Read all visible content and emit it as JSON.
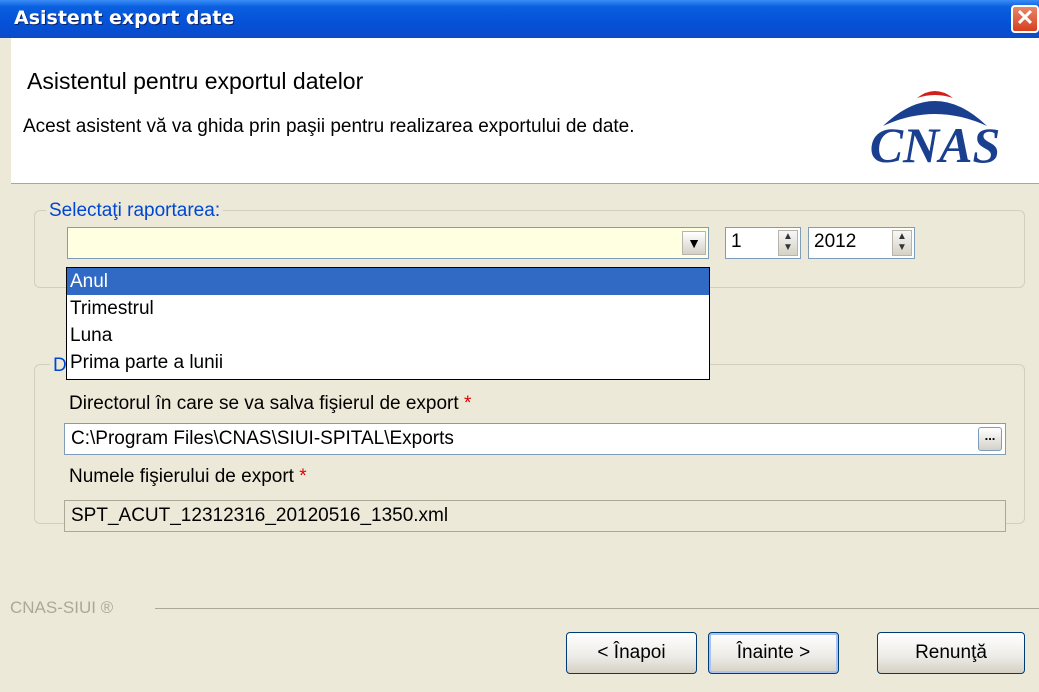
{
  "window": {
    "title": "Asistent export date",
    "close_label": "✕"
  },
  "header": {
    "title": "Asistentul pentru exportul datelor",
    "subtitle": "Acest asistent vă va ghida prin paşii pentru realizarea exportului de date.",
    "logo_text": "CNAS"
  },
  "report_group": {
    "legend": "Selectaţi raportarea:",
    "combo_value": "",
    "period_value": "1",
    "year_value": "2012",
    "options": [
      "Anul",
      "Trimestrul",
      "Luna",
      "Prima parte a lunii"
    ],
    "selected_option": "Anul"
  },
  "export_group": {
    "legend_visible_char": "D",
    "dir_label": "Directorul în care se va salva fişierul de export",
    "dir_value": "C:\\Program Files\\CNAS\\SIUI-SPITAL\\Exports",
    "browse_label": "...",
    "file_label": "Numele fişierului de export",
    "file_value": "SPT_ACUT_12312316_20120516_1350.xml",
    "required_mark": "*"
  },
  "footer": {
    "brand": "CNAS-SIUI ®",
    "back_label": "< Înapoi",
    "next_label": "Înainte >",
    "cancel_label": "Renunţă"
  },
  "colors": {
    "titlebar": "#0551D8",
    "selection": "#316AC5",
    "combo_bg": "#FFFFE1",
    "logo_blue": "#1B3F8F",
    "logo_red": "#D0201E"
  }
}
